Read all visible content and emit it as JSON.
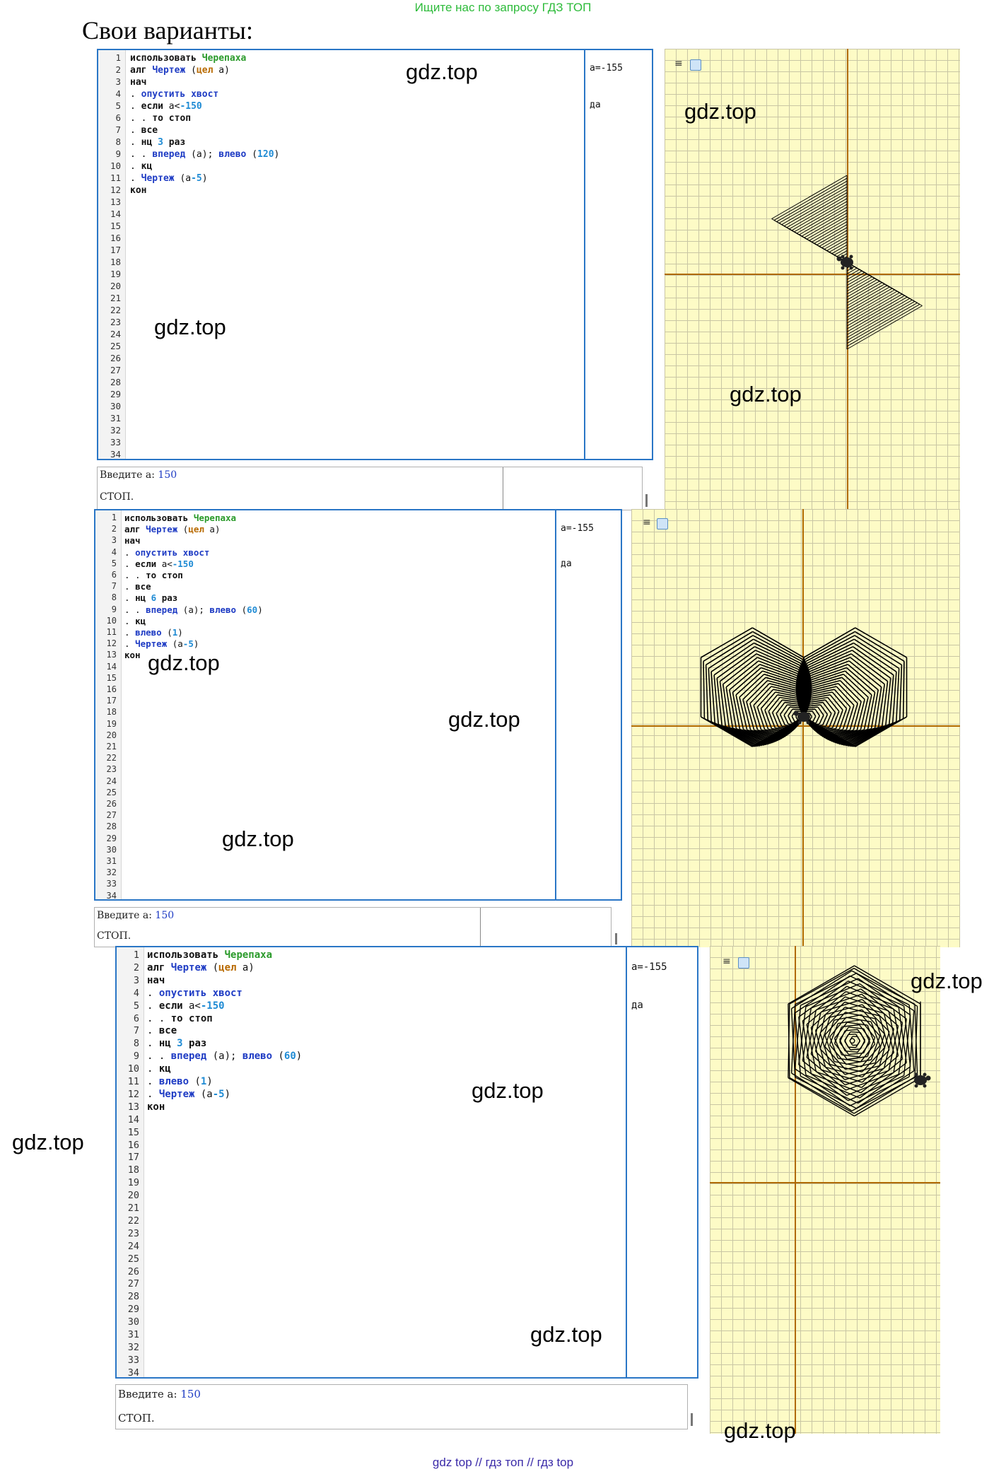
{
  "header_note": "Ищите нас по запросу ГДЗ ТОП",
  "heading": "Свои варианты:",
  "watermark": "gdz.top",
  "footer": "gdz top // гдз топ // гдз top",
  "variants": [
    {
      "code": [
        "использовать Черепаха",
        "алг Чертеж (цел a)",
        "нач",
        ". опустить хвост",
        ". если a<-150",
        ". . то стоп",
        ". все",
        ". нц 3 раз",
        ". . вперед (a); влево (120)",
        ". кц",
        ". Чертеж (a-5)",
        "кон"
      ],
      "side_values": [
        "a=-155",
        "да"
      ],
      "console": {
        "prompt": "Введите a:",
        "value": "150",
        "output": "СТОП."
      },
      "shape": "two-triangles"
    },
    {
      "code": [
        "использовать Черепаха",
        "алг Чертеж (цел a)",
        "нач",
        ". опустить хвост",
        ". если a<-150",
        ". . то стоп",
        ". все",
        ". нц 6 раз",
        ". . вперед (a); влево (60)",
        ". кц",
        ". влево (1)",
        ". Чертеж (a-5)",
        "кон"
      ],
      "side_values": [
        "a=-155",
        "да"
      ],
      "console": {
        "prompt": "Введите a:",
        "value": "150",
        "output": "СТОП."
      },
      "shape": "two-hexagon-spirals"
    },
    {
      "code": [
        "использовать Черепаха",
        "алг Чертеж (цел a)",
        "нач",
        ". опустить хвост",
        ". если a<-150",
        ". . то стоп",
        ". все",
        ". нц 3 раз",
        ". . вперед (a); влево (60)",
        ". кц",
        ". влево (1)",
        ". Чертеж (a-5)",
        "кон"
      ],
      "side_values": [
        "a=-155",
        "да"
      ],
      "console": {
        "prompt": "Введите a:",
        "value": "150",
        "output": "СТОП."
      },
      "shape": "hexagon-spiral"
    }
  ],
  "line_count": 34,
  "colors": {
    "accent": "#2a76c6",
    "canvas": "#fdfbc6",
    "grid": "#c9c6a4",
    "axis": "#b06a00",
    "keyword_fn": "#1f3cc4",
    "module": "#2a9a2a",
    "number": "#1f8bd4"
  },
  "icons": [
    "hamburger-icon",
    "checkbox-icon",
    "turtle-icon"
  ]
}
